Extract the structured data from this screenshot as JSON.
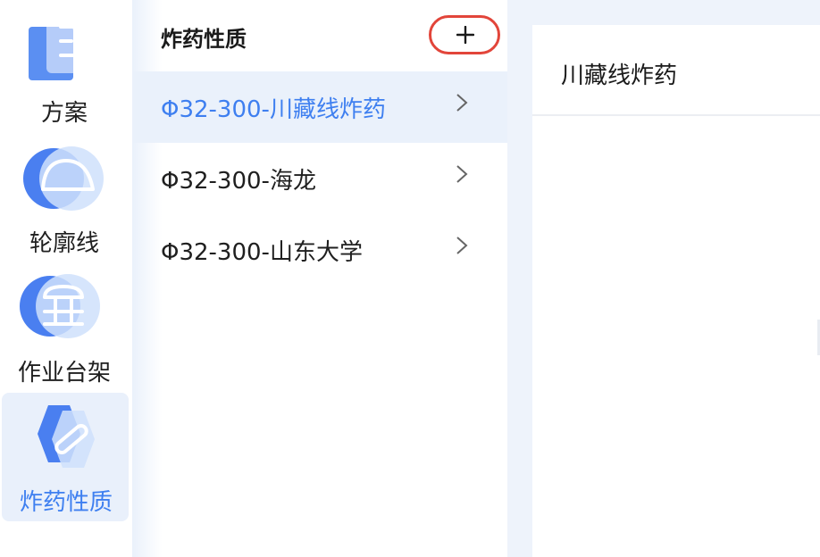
{
  "nav": {
    "items": [
      {
        "label": "方案"
      },
      {
        "label": "轮廓线"
      },
      {
        "label": "作业台架"
      },
      {
        "label": "炸药性质"
      }
    ],
    "active_index": 3
  },
  "list": {
    "title": "炸药性质",
    "add_symbol": "+",
    "items": [
      {
        "label": "Φ32-300-川藏线炸药"
      },
      {
        "label": "Φ32-300-海龙"
      },
      {
        "label": "Φ32-300-山东大学"
      }
    ],
    "selected_index": 0
  },
  "detail": {
    "title": "川藏线炸药"
  },
  "colors": {
    "accent": "#3e7ff0",
    "highlight_ring": "#e2453a",
    "selected_bg": "#eaf1fb"
  }
}
